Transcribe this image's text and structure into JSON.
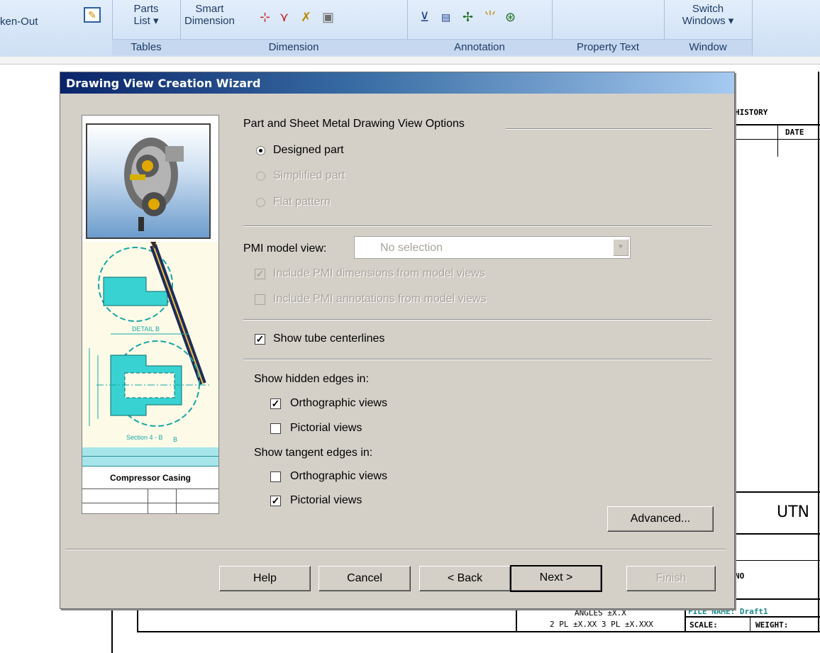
{
  "ribbon": {
    "partial_button": "ken-Out",
    "parts_list_top": "Parts",
    "parts_list_bottom": "List ▾",
    "tables_label": "Tables",
    "smart_top": "Smart",
    "smart_bottom": "Dimension",
    "dimension_label": "Dimension",
    "annotation_label": "Annotation",
    "property_text_label": "Property Text",
    "switch_top": "Switch",
    "switch_bottom": "Windows ▾",
    "window_label": "Window"
  },
  "sheet": {
    "history": "HISTORY",
    "date": "DATE",
    "utn": "UTN",
    "angles": "ANGLES ±X.X",
    "tolerance": "2 PL ±X.XX 3 PL ±X.XXX",
    "file_name": "FILE NAME: Draft1",
    "scale": "SCALE:",
    "weight": "WEIGHT:",
    "dwg_no": "NO"
  },
  "dialog": {
    "title": "Drawing View Creation Wizard",
    "section_title": "Part and Sheet Metal Drawing View Options",
    "radio_options": [
      {
        "label": "Designed part",
        "selected": true,
        "enabled": true
      },
      {
        "label": "Simplified part",
        "selected": false,
        "enabled": false
      },
      {
        "label": "Flat pattern",
        "selected": false,
        "enabled": false
      }
    ],
    "pmi_label": "PMI model view:",
    "pmi_value": "No selection",
    "pmi_dims": "Include PMI dimensions from model views",
    "pmi_annots": "Include PMI annotations from model views",
    "tube_centerlines": "Show tube centerlines",
    "hidden_header": "Show hidden edges in:",
    "hidden_ortho": "Orthographic views",
    "hidden_pictorial": "Pictorial views",
    "tangent_header": "Show tangent edges in:",
    "tangent_ortho": "Orthographic views",
    "tangent_pictorial": "Pictorial views",
    "advanced": "Advanced...",
    "buttons": {
      "help": "Help",
      "cancel": "Cancel",
      "back": "< Back",
      "next": "Next >",
      "finish": "Finish"
    },
    "preview": {
      "detail_label": "DETAIL B",
      "section_label": "Section 4 - B",
      "section_mark": "B",
      "title_block_name": "Compressor Casing"
    }
  }
}
